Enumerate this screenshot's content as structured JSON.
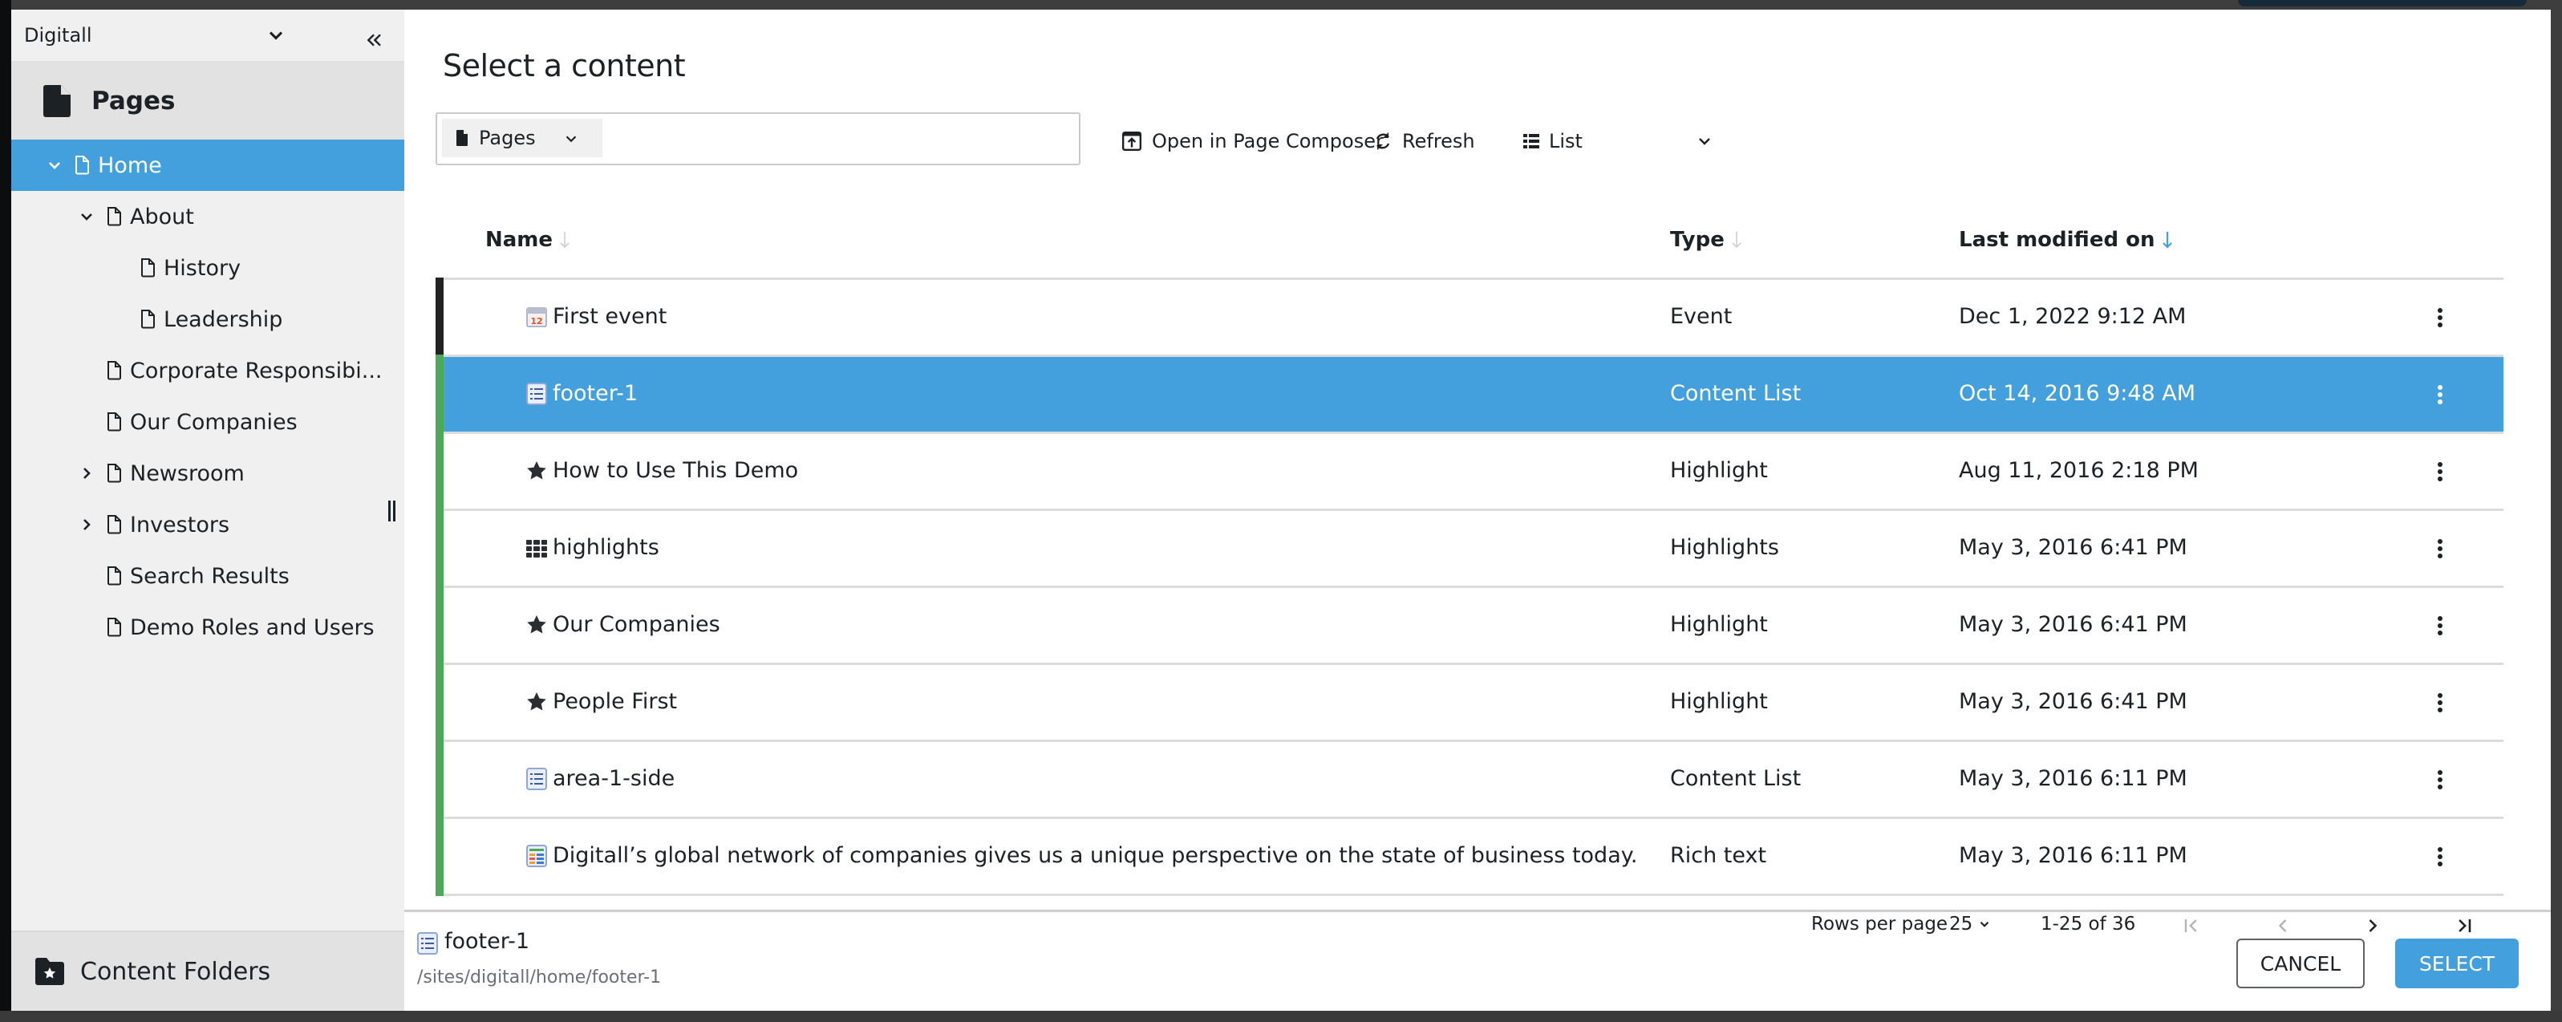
{
  "colors": {
    "accent": "#44a0dc",
    "sidebar_bg": "#f0f0f0",
    "section_header_bg": "#e2e2e2",
    "text": "#1c2125",
    "row_bar_dark": "#222222",
    "row_bar_green": "#4ea85a",
    "muted_text": "#6b6f74"
  },
  "sidebar": {
    "site_name": "Digitall",
    "site_chevron_icon": "chevron-down-icon",
    "collapse_icon": "double-chevron-left-icon",
    "section_title": "Pages",
    "section_icon": "file-icon",
    "tree": [
      {
        "label": "Home",
        "level": 0,
        "expander": "expanded",
        "selected": true
      },
      {
        "label": "About",
        "level": 1,
        "expander": "expanded",
        "selected": false
      },
      {
        "label": "History",
        "level": 2,
        "expander": "none",
        "selected": false
      },
      {
        "label": "Leadership",
        "level": 2,
        "expander": "none",
        "selected": false
      },
      {
        "label": "Corporate Responsibi...",
        "level": 1,
        "expander": "none",
        "selected": false
      },
      {
        "label": "Our Companies",
        "level": 1,
        "expander": "none",
        "selected": false
      },
      {
        "label": "Newsroom",
        "level": 1,
        "expander": "collapsed",
        "selected": false
      },
      {
        "label": "Investors",
        "level": 1,
        "expander": "collapsed",
        "selected": false
      },
      {
        "label": "Search Results",
        "level": 1,
        "expander": "none",
        "selected": false
      },
      {
        "label": "Demo Roles and Users",
        "level": 1,
        "expander": "none",
        "selected": false
      }
    ],
    "footer_label": "Content Folders",
    "footer_icon": "star-folder-icon"
  },
  "dialog": {
    "title": "Select a content",
    "search": {
      "type_filter": "Pages",
      "value": "",
      "placeholder": ""
    },
    "toolbar": {
      "open_composer": "Open in Page Composer",
      "refresh": "Refresh",
      "view_mode": "List"
    },
    "table": {
      "columns": [
        {
          "label": "Name",
          "sort": "inactive"
        },
        {
          "label": "Type",
          "sort": "inactive"
        },
        {
          "label": "Last modified on",
          "sort": "active-desc"
        }
      ],
      "rows": [
        {
          "name": "First event",
          "type": "Event",
          "modified": "Dec 1, 2022 9:12 AM",
          "icon": "calendar-icon",
          "status": "dark",
          "selected": false
        },
        {
          "name": "footer-1",
          "type": "Content List",
          "modified": "Oct 14, 2016 9:48 AM",
          "icon": "list-icon",
          "status": "green",
          "selected": true
        },
        {
          "name": "How to Use This Demo",
          "type": "Highlight",
          "modified": "Aug 11, 2016 2:18 PM",
          "icon": "star-icon",
          "status": "green",
          "selected": false
        },
        {
          "name": "highlights",
          "type": "Highlights",
          "modified": "May 3, 2016 6:41 PM",
          "icon": "grid-icon",
          "status": "green",
          "selected": false
        },
        {
          "name": "Our Companies",
          "type": "Highlight",
          "modified": "May 3, 2016 6:41 PM",
          "icon": "star-icon",
          "status": "green",
          "selected": false
        },
        {
          "name": "People First",
          "type": "Highlight",
          "modified": "May 3, 2016 6:41 PM",
          "icon": "star-icon",
          "status": "green",
          "selected": false
        },
        {
          "name": "area-1-side",
          "type": "Content List",
          "modified": "May 3, 2016 6:11 PM",
          "icon": "list-icon",
          "status": "green",
          "selected": false
        },
        {
          "name": "Digitall’s global network of companies gives us a unique perspective on the state of business today. To mee",
          "type": "Rich text",
          "modified": "May 3, 2016 6:11 PM",
          "icon": "rich-text-icon",
          "status": "green",
          "selected": false
        }
      ]
    },
    "selection": {
      "name": "footer-1",
      "path": "/sites/digitall/home/footer-1",
      "icon": "list-icon"
    },
    "pagination": {
      "rows_per_page_label": "Rows per page",
      "rows_per_page": "25",
      "range": "1-25 of 36"
    },
    "buttons": {
      "cancel": "CANCEL",
      "select": "SELECT"
    }
  }
}
